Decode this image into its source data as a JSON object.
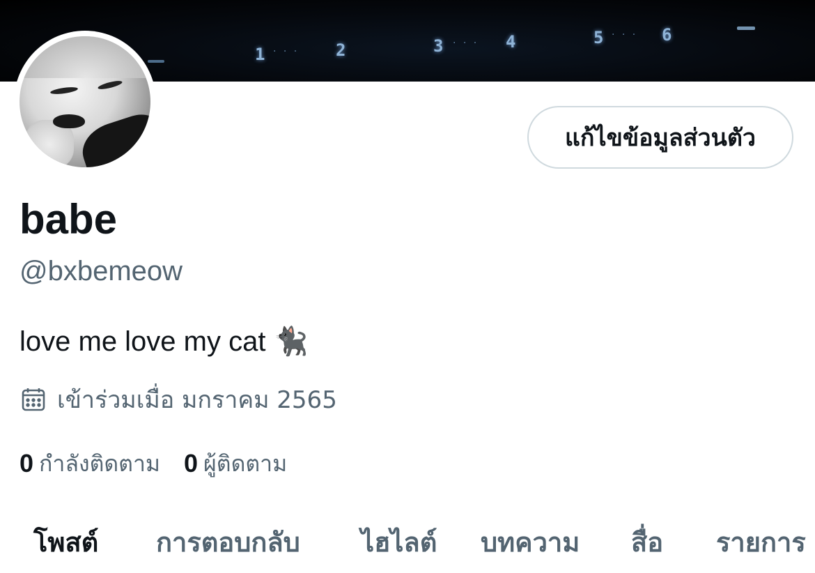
{
  "banner": {
    "numbers": [
      "1",
      "2",
      "3",
      "4",
      "5",
      "6"
    ]
  },
  "profile": {
    "edit_button_label": "แก้ไขข้อมูลส่วนตัว",
    "display_name": "babe",
    "handle": "@bxbemeow",
    "bio": "love me love my cat 🐈‍⬛",
    "joined": "เข้าร่วมเมื่อ มกราคม 2565"
  },
  "stats": {
    "following_count": "0",
    "following_label": "กำลังติดตาม",
    "followers_count": "0",
    "followers_label": "ผู้ติดตาม"
  },
  "tabs": [
    {
      "label": "โพสต์",
      "active": true
    },
    {
      "label": "การตอบกลับ",
      "active": false
    },
    {
      "label": "ไฮไลต์",
      "active": false
    },
    {
      "label": "บทความ",
      "active": false
    },
    {
      "label": "สื่อ",
      "active": false
    },
    {
      "label": "รายการ",
      "active": false
    }
  ],
  "icons": {
    "calendar": "calendar-icon"
  },
  "colors": {
    "text_primary": "#0f1419",
    "text_secondary": "#536471",
    "button_border": "#cfd9de"
  }
}
